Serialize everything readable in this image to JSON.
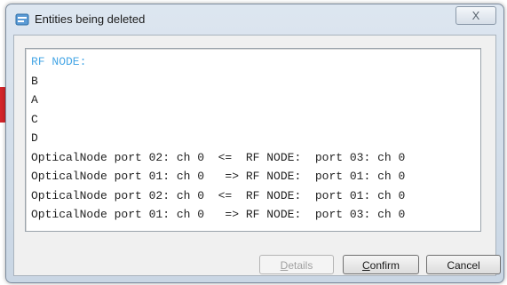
{
  "window": {
    "title": "Entities being deleted",
    "close_label": "X"
  },
  "content": {
    "lines": [
      "RF NODE:",
      "B",
      "A",
      "C",
      "D",
      "OpticalNode port 02: ch 0  <=  RF NODE:  port 03: ch 0",
      "OpticalNode port 01: ch 0   => RF NODE:  port 01: ch 0",
      "OpticalNode port 02: ch 0  <=  RF NODE:  port 01: ch 0",
      "OpticalNode port 01: ch 0   => RF NODE:  port 03: ch 0"
    ]
  },
  "buttons": {
    "details": {
      "first": "D",
      "rest": "etails",
      "enabled": false
    },
    "confirm": {
      "first": "C",
      "rest": "onfirm",
      "enabled": true
    },
    "cancel": {
      "label": "Cancel",
      "enabled": true
    }
  },
  "colors": {
    "highlight_text": "#4aa8e6",
    "background_tab": "#d4252a"
  }
}
